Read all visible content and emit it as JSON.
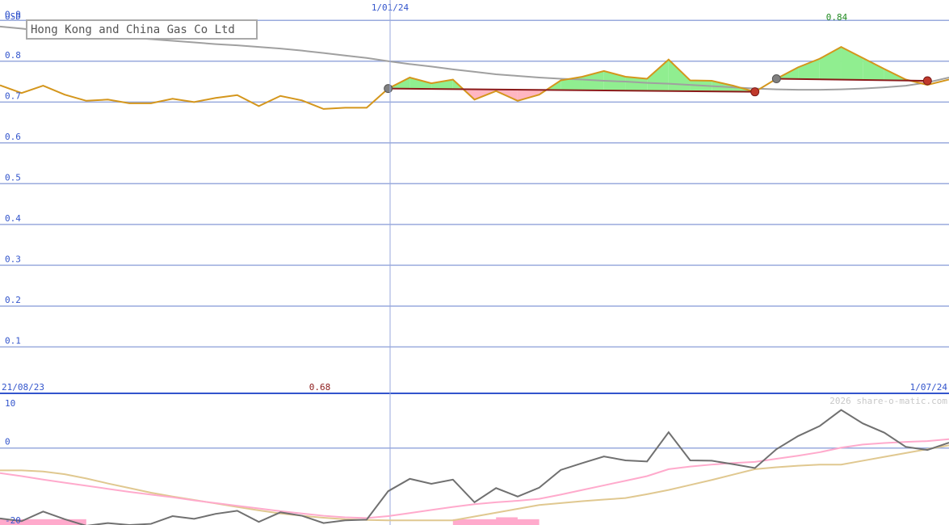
{
  "chart_data": [
    {
      "type": "line",
      "title": "Hong Kong and China Gas Co Ltd",
      "ylabel": "USD",
      "ylim": [
        0.0,
        0.95
      ],
      "yticks": [
        0.1,
        0.2,
        0.3,
        0.4,
        0.5,
        0.6,
        0.7,
        0.8,
        0.9
      ],
      "ytick_labels": [
        "0.1",
        "0.2",
        "0.3",
        "0.4",
        "0.5",
        "0.6",
        "0.7",
        "0.8",
        "0.9"
      ],
      "x_start_label": "21/08/23",
      "x_mid_label": "1/01/24",
      "x_end_label": "1/07/24",
      "low_label": "0.68",
      "high_label": "0.84",
      "grid": true,
      "colors": {
        "price": "#d4961c",
        "long_ma": "#a0a0a0",
        "trend": "#8b1a1a",
        "gain_fill": "#90ee90",
        "loss_fill": "#ffb6c1",
        "grid": "#99aadd",
        "low_label": "#8b1a1a",
        "high_label": "#228b22"
      },
      "price": [
        0.741,
        0.722,
        0.74,
        0.718,
        0.703,
        0.706,
        0.697,
        0.697,
        0.708,
        0.7,
        0.71,
        0.717,
        0.69,
        0.715,
        0.704,
        0.683,
        0.686,
        0.686,
        0.733,
        0.76,
        0.746,
        0.755,
        0.706,
        0.727,
        0.703,
        0.718,
        0.753,
        0.762,
        0.776,
        0.762,
        0.757,
        0.804,
        0.753,
        0.752,
        0.74,
        0.725,
        0.757,
        0.785,
        0.806,
        0.835,
        0.808,
        0.781,
        0.755,
        0.742,
        0.755
      ],
      "long_ma": [
        0.885,
        0.88,
        0.874,
        0.869,
        0.866,
        0.862,
        0.858,
        0.854,
        0.85,
        0.846,
        0.842,
        0.839,
        0.835,
        0.831,
        0.826,
        0.82,
        0.814,
        0.808,
        0.8,
        0.793,
        0.787,
        0.78,
        0.774,
        0.768,
        0.764,
        0.76,
        0.757,
        0.755,
        0.752,
        0.75,
        0.747,
        0.745,
        0.742,
        0.739,
        0.736,
        0.733,
        0.731,
        0.73,
        0.73,
        0.731,
        0.733,
        0.736,
        0.74,
        0.748,
        0.76
      ],
      "trend_segments": [
        {
          "start_index": 18,
          "end_index": 35,
          "start_value": 0.733,
          "end_value": 0.725
        },
        {
          "start_index": 36,
          "end_index": 43,
          "start_value": 0.757,
          "end_value": 0.752
        }
      ]
    },
    {
      "type": "line",
      "ylim": [
        -20,
        14
      ],
      "yticks": [
        -20,
        0,
        10
      ],
      "ytick_labels": [
        "-20",
        "0",
        "10"
      ],
      "watermark": "2026 share-o-matic.com",
      "colors": {
        "oscillator": "#707070",
        "signal_fast": "#ffaacc",
        "signal_slow": "#e0c890"
      },
      "series": [
        {
          "values": [
            -18.3,
            -19.0,
            -16.5,
            -18.5,
            -20.2,
            -19.5,
            -20.0,
            -19.7,
            -17.7,
            -18.4,
            -17.1,
            -16.3,
            -19.2,
            -16.7,
            -17.6,
            -19.5,
            -18.8,
            -18.6,
            -11.2,
            -8.0,
            -9.3,
            -8.2,
            -14.1,
            -10.4,
            -12.6,
            -10.3,
            -5.7,
            -3.9,
            -2.2,
            -3.2,
            -3.5,
            4.1,
            -3.2,
            -3.3,
            -4.2,
            -5.2,
            -0.3,
            3.1,
            5.7,
            9.9,
            6.4,
            4.0,
            0.3,
            -0.5,
            1.4
          ]
        },
        {
          "values": [
            -6.5,
            -7.3,
            -8.2,
            -9.0,
            -9.8,
            -10.6,
            -11.4,
            -12.1,
            -12.8,
            -13.6,
            -14.3,
            -15.0,
            -15.7,
            -16.4,
            -17.0,
            -17.6,
            -18.0,
            -18.2,
            -17.7,
            -16.9,
            -16.1,
            -15.3,
            -14.6,
            -14.1,
            -13.7,
            -13.2,
            -12.1,
            -10.9,
            -9.7,
            -8.5,
            -7.3,
            -5.5,
            -4.8,
            -4.3,
            -3.9,
            -3.6,
            -2.8,
            -2.0,
            -1.1,
            0.1,
            0.9,
            1.3,
            1.6,
            1.8,
            2.3
          ]
        },
        {
          "values": [
            -5.8,
            -5.8,
            -6.1,
            -6.8,
            -7.9,
            -9.2,
            -10.4,
            -11.6,
            -12.6,
            -13.5,
            -14.4,
            -15.3,
            -16.2,
            -17.0,
            -17.6,
            -18.1,
            -18.5,
            -18.7,
            -18.8,
            -18.8,
            -18.8,
            -18.8,
            -17.8,
            -16.8,
            -15.8,
            -14.8,
            -14.3,
            -13.8,
            -13.4,
            -13.0,
            -12.0,
            -10.9,
            -9.6,
            -8.3,
            -6.9,
            -5.5,
            -5.0,
            -4.6,
            -4.3,
            -4.3,
            -3.3,
            -2.3,
            -1.3,
            -0.3,
            0.7
          ]
        }
      ],
      "bars": [
        {
          "start_index": 0,
          "end_index": 4,
          "value": -1.5
        },
        {
          "start_index": 21,
          "end_index": 25,
          "value": -1.5
        },
        {
          "start_index": 23,
          "end_index": 24,
          "value": -2.0
        }
      ]
    }
  ]
}
